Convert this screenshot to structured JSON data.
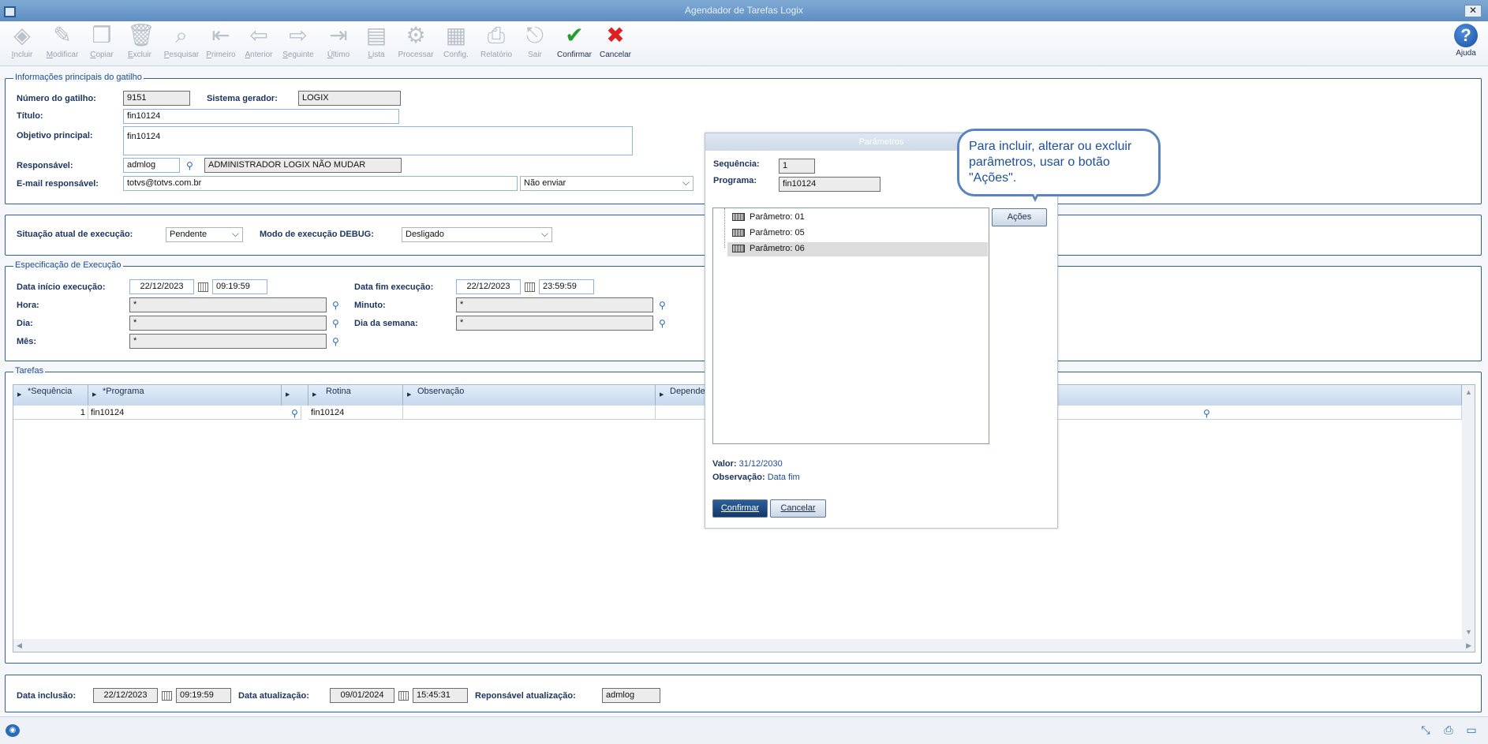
{
  "window": {
    "title": "Agendador de Tarefas Logix"
  },
  "toolbar": {
    "items": [
      {
        "label": "Incluir",
        "u": "I",
        "rest": "ncluir",
        "icon": "◈",
        "active": false
      },
      {
        "label": "Modificar",
        "u": "M",
        "rest": "odificar",
        "icon": "✎",
        "active": false
      },
      {
        "label": "Copiar",
        "u": "C",
        "rest": "opiar",
        "icon": "❐",
        "active": false
      },
      {
        "label": "Excluir",
        "u": "E",
        "rest": "xcluir",
        "icon": "🗑",
        "active": false
      },
      {
        "label": "Pesquisar",
        "u": "P",
        "rest": "esquisar",
        "icon": "⌕",
        "active": false
      },
      {
        "label": "Primeiro",
        "u": "P",
        "rest": "rimeiro",
        "icon": "⇤",
        "active": false
      },
      {
        "label": "Anterior",
        "u": "A",
        "rest": "nterior",
        "icon": "⇦",
        "active": false
      },
      {
        "label": "Seguinte",
        "u": "S",
        "rest": "eguinte",
        "icon": "⇨",
        "active": false
      },
      {
        "label": "Último",
        "u": "Ú",
        "rest": "ltimo",
        "icon": "⇥",
        "active": false
      },
      {
        "label": "Lista",
        "u": "L",
        "rest": "ista",
        "icon": "▤",
        "active": false
      },
      {
        "label": "Processar",
        "u": "",
        "rest": "Processar",
        "icon": "⚙",
        "active": false
      },
      {
        "label": "Config.",
        "u": "",
        "rest": "Config.",
        "icon": "▦",
        "active": false
      },
      {
        "label": "Relatório",
        "u": "",
        "rest": "Relatório",
        "icon": "⎙",
        "active": false
      },
      {
        "label": "Sair",
        "u": "",
        "rest": "Sair",
        "icon": "⎋",
        "active": false
      },
      {
        "label": "Confirmar",
        "u": "",
        "rest": "Confirmar",
        "icon": "✔",
        "active": true
      },
      {
        "label": "Cancelar",
        "u": "",
        "rest": "Cancelar",
        "icon": "✖",
        "active": true
      }
    ],
    "help_label": "Ajuda",
    "help_icon": "?"
  },
  "main_info": {
    "legend": "Informações principais do gatilho",
    "numero_label": "Número do gatilho:",
    "numero_value": "9151",
    "sistema_label": "Sistema gerador:",
    "sistema_value": "LOGIX",
    "titulo_label": "Título:",
    "titulo_value": "fin10124",
    "objetivo_label": "Objetivo principal:",
    "objetivo_value": "fin10124",
    "responsavel_label": "Responsável:",
    "responsavel_code": "admlog",
    "responsavel_name": "ADMINISTRADOR LOGIX NÃO MUDAR",
    "email_label": "E-mail responsável:",
    "email_value": "totvs@totvs.com.br",
    "email_option": "Não enviar"
  },
  "situacao": {
    "situacao_label": "Situação atual de execução:",
    "situacao_value": "Pendente",
    "debug_label": "Modo de execução DEBUG:",
    "debug_value": "Desligado"
  },
  "execucao": {
    "legend": "Especificação de Execução",
    "inicio_label": "Data início execução:",
    "inicio_date": "22/12/2023",
    "inicio_time": "09:19:59",
    "fim_label": "Data fim execução:",
    "fim_date": "22/12/2023",
    "fim_time": "23:59:59",
    "hora_label": "Hora:",
    "hora_value": "*",
    "minuto_label": "Minuto:",
    "minuto_value": "*",
    "dia_label": "Dia:",
    "dia_value": "*",
    "dia_semana_label": "Dia da semana:",
    "dia_semana_value": "*",
    "mes_label": "Mês:",
    "mes_value": "*"
  },
  "tarefas": {
    "legend": "Tarefas",
    "columns": [
      "*Sequência",
      "*Programa",
      "Rotina",
      "Observação",
      "Depende"
    ],
    "rows": [
      {
        "sequencia": "1",
        "programa": "fin10124",
        "rotina": "fin10124",
        "observacao": "",
        "depende": ""
      }
    ]
  },
  "footer": {
    "inclusao_label": "Data inclusão:",
    "inclusao_date": "22/12/2023",
    "inclusao_time": "09:19:59",
    "atualizacao_label": "Data atualização:",
    "atualizacao_date": "09/01/2024",
    "atualizacao_time": "15:45:31",
    "resp_label": "Reponsável atualização:",
    "resp_value": "admlog"
  },
  "dialog": {
    "title": "Parâmetros",
    "sequencia_label": "Sequência:",
    "sequencia_value": "1",
    "programa_label": "Programa:",
    "programa_value": "fin10124",
    "acoes_label": "Ações",
    "params": [
      "Parâmetro: 01",
      "Parâmetro: 05",
      "Parâmetro: 06"
    ],
    "selected_param": 2,
    "valor_label": "Valor:",
    "valor_value": "31/12/2030",
    "observacao_label": "Observação:",
    "observacao_value": "Data fim",
    "confirmar_label": "Confirmar",
    "cancelar_label": "Cancelar"
  },
  "callout": {
    "text": "Para incluir, alterar ou excluir parâmetros, usar o botão \"Ações\"."
  }
}
